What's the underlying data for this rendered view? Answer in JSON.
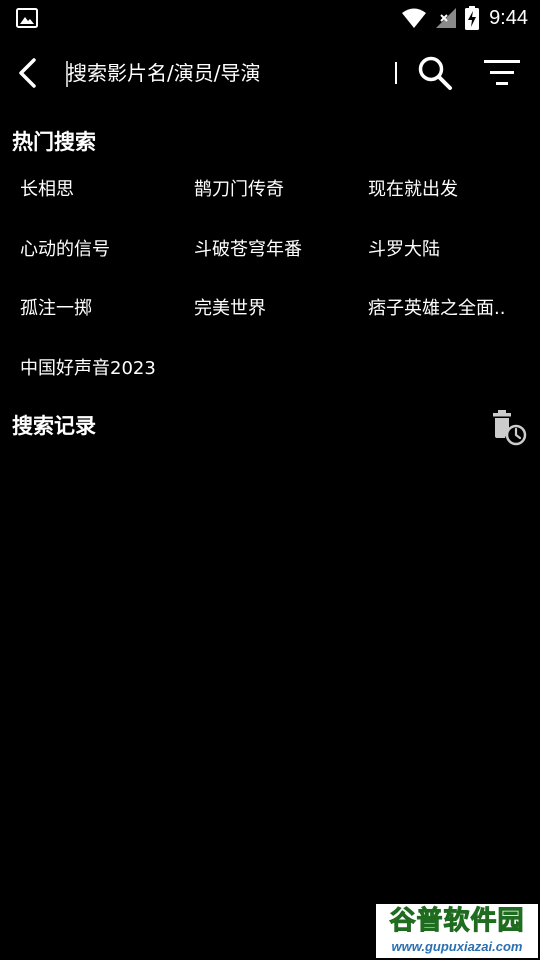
{
  "status_bar": {
    "time": "9:44",
    "icons": [
      "image-icon",
      "wifi-icon",
      "signal-icon",
      "battery-charging-icon"
    ]
  },
  "toolbar": {
    "back_icon": "chevron-left-icon",
    "search_placeholder": "搜索影片名/演员/导演",
    "search_icon": "search-icon",
    "filter_icon": "filter-icon"
  },
  "hot_search": {
    "title": "热门搜索",
    "items": [
      "长相思",
      "鹊刀门传奇",
      "现在就出发",
      "心动的信号",
      "斗破苍穹年番",
      "斗罗大陆",
      "孤注一掷",
      "完美世界",
      "痞子英雄之全面..",
      "中国好声音2023"
    ]
  },
  "search_history": {
    "title": "搜索记录",
    "clear_icon": "trash-clock-icon"
  },
  "watermark": {
    "logo_text": "谷普软件园",
    "url": "www.gupuxiazai.com"
  },
  "colors": {
    "background": "#000000",
    "text": "#ffffff",
    "icon": "#ffffff",
    "clear_icon": "#cccccc"
  }
}
